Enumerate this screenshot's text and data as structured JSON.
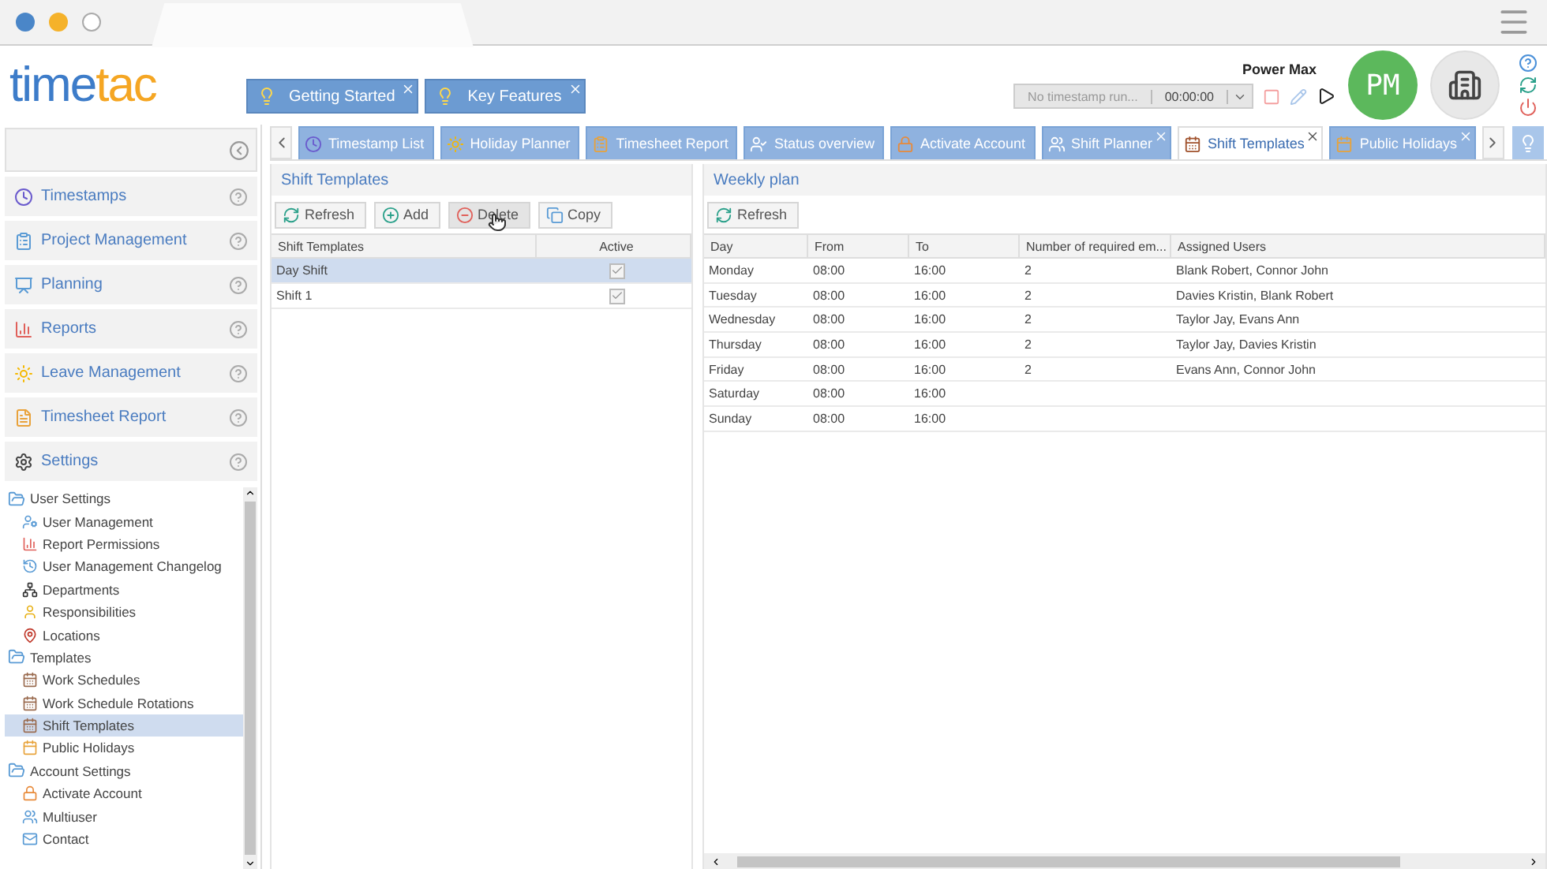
{
  "logo": {
    "first": "time",
    "second": "tac"
  },
  "tips": [
    {
      "label": "Getting Started",
      "closable": true
    },
    {
      "label": "Key Features",
      "closable": true
    }
  ],
  "user": {
    "name": "Power Max",
    "initials": "PM",
    "timer_placeholder": "No timestamp run...",
    "timer_value": "00:00:00"
  },
  "tabs": [
    {
      "label": "Timestamp List",
      "selected": false,
      "closable": false
    },
    {
      "label": "Holiday Planner",
      "selected": false,
      "closable": false
    },
    {
      "label": "Timesheet Report",
      "selected": false,
      "closable": false
    },
    {
      "label": "Status overview",
      "selected": false,
      "closable": false
    },
    {
      "label": "Activate Account",
      "selected": false,
      "closable": false
    },
    {
      "label": "Shift Planner",
      "selected": false,
      "closable": true
    },
    {
      "label": "Shift Templates",
      "selected": true,
      "closable": true
    },
    {
      "label": "Public Holidays",
      "selected": false,
      "closable": true
    }
  ],
  "sidebar": {
    "sections": [
      {
        "label": "Timestamps"
      },
      {
        "label": "Project Management"
      },
      {
        "label": "Planning"
      },
      {
        "label": "Reports"
      },
      {
        "label": "Leave Management"
      },
      {
        "label": "Timesheet Report"
      },
      {
        "label": "Settings"
      }
    ],
    "tree": [
      {
        "label": "User Settings",
        "children": [
          {
            "label": "User Management",
            "selected": false
          },
          {
            "label": "Report Permissions",
            "selected": false
          },
          {
            "label": "User Management Changelog",
            "selected": false
          },
          {
            "label": "Departments",
            "selected": false
          },
          {
            "label": "Responsibilities",
            "selected": false
          },
          {
            "label": "Locations",
            "selected": false
          }
        ]
      },
      {
        "label": "Templates",
        "children": [
          {
            "label": "Work Schedules",
            "selected": false
          },
          {
            "label": "Work Schedule Rotations",
            "selected": false
          },
          {
            "label": "Shift Templates",
            "selected": true
          },
          {
            "label": "Public Holidays",
            "selected": false
          }
        ]
      },
      {
        "label": "Account Settings",
        "children": [
          {
            "label": "Activate Account",
            "selected": false
          },
          {
            "label": "Multiuser",
            "selected": false
          },
          {
            "label": "Contact",
            "selected": false
          }
        ]
      }
    ]
  },
  "shift_templates": {
    "title": "Shift Templates",
    "buttons": [
      {
        "label": "Refresh",
        "kind": "refresh",
        "pressed": false
      },
      {
        "label": "Add",
        "kind": "add",
        "pressed": false
      },
      {
        "label": "Delete",
        "kind": "delete",
        "pressed": true
      },
      {
        "label": "Copy",
        "kind": "copy",
        "pressed": false
      }
    ],
    "columns": [
      "Shift Templates",
      "Active"
    ],
    "rows": [
      {
        "name": "Day Shift",
        "active": true,
        "selected": true
      },
      {
        "name": "Shift 1",
        "active": true,
        "selected": false
      }
    ]
  },
  "weekly_plan": {
    "title": "Weekly plan",
    "refresh": "Refresh",
    "columns": [
      "Day",
      "From",
      "To",
      "Number of required em...",
      "Assigned Users"
    ],
    "rows": [
      [
        "Monday",
        "08:00",
        "16:00",
        "2",
        "Blank Robert, Connor John"
      ],
      [
        "Tuesday",
        "08:00",
        "16:00",
        "2",
        "Davies Kristin, Blank Robert"
      ],
      [
        "Wednesday",
        "08:00",
        "16:00",
        "2",
        "Taylor Jay, Evans Ann"
      ],
      [
        "Thursday",
        "08:00",
        "16:00",
        "2",
        "Taylor Jay, Davies Kristin"
      ],
      [
        "Friday",
        "08:00",
        "16:00",
        "2",
        "Evans Ann, Connor John"
      ],
      [
        "Saturday",
        "08:00",
        "16:00"
      ],
      [
        "Sunday",
        "08:00",
        "16:00"
      ]
    ]
  }
}
